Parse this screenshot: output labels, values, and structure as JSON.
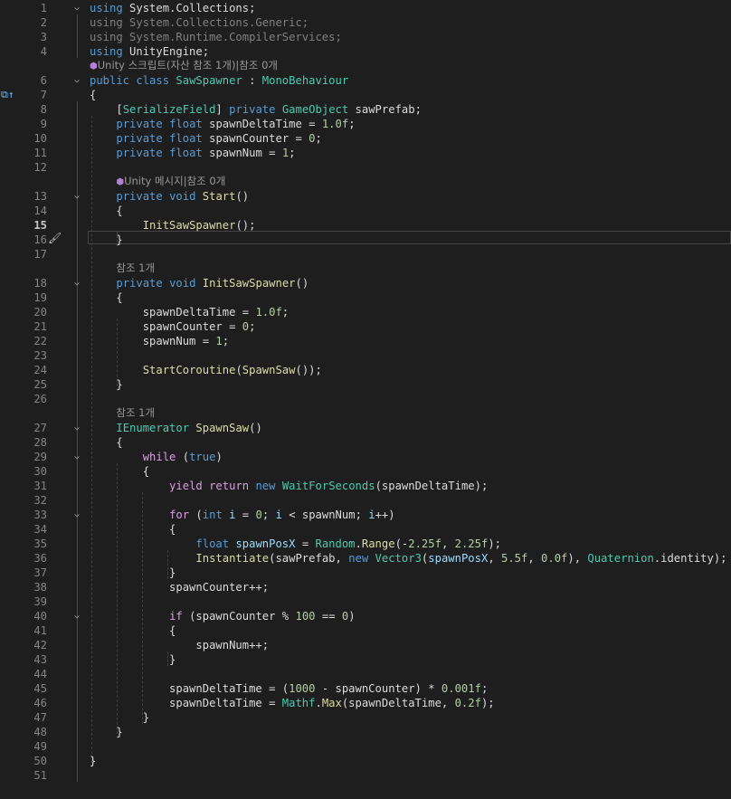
{
  "editor": {
    "active_line": 15,
    "lines": [
      {
        "n": 1,
        "fold": "v",
        "code": [
          [
            "k",
            "using"
          ],
          [
            "p",
            " System.Collections;"
          ]
        ]
      },
      {
        "n": 2,
        "code": [
          [
            "d",
            "using System.Collections.Generic;"
          ]
        ]
      },
      {
        "n": 3,
        "code": [
          [
            "d",
            "using System.Runtime.CompilerServices;"
          ]
        ]
      },
      {
        "n": 4,
        "code": [
          [
            "k",
            "using"
          ],
          [
            "p",
            " UnityEngine;"
          ]
        ]
      },
      {
        "lens": "Unity 스크립트(자산 참조 1개)|참조 0개",
        "icon": "unity-icon"
      },
      {
        "n": 6,
        "fold": "v",
        "code": [
          [
            "k",
            "public"
          ],
          [
            "p",
            " "
          ],
          [
            "k",
            "class"
          ],
          [
            "p",
            " "
          ],
          [
            "t",
            "SawSpawner"
          ],
          [
            "p",
            " : "
          ],
          [
            "t",
            "MonoBehaviour"
          ]
        ]
      },
      {
        "n": 7,
        "code": [
          [
            "p",
            "{"
          ]
        ]
      },
      {
        "n": 8,
        "code": [
          [
            "p",
            "    ["
          ],
          [
            "t",
            "SerializeField"
          ],
          [
            "p",
            "] "
          ],
          [
            "k",
            "private"
          ],
          [
            "p",
            " "
          ],
          [
            "t",
            "GameObject"
          ],
          [
            "p",
            " sawPrefab;"
          ]
        ]
      },
      {
        "n": 9,
        "code": [
          [
            "p",
            "    "
          ],
          [
            "k",
            "private"
          ],
          [
            "p",
            " "
          ],
          [
            "k",
            "float"
          ],
          [
            "p",
            " spawnDeltaTime = "
          ],
          [
            "n",
            "1.0f"
          ],
          [
            "p",
            ";"
          ]
        ]
      },
      {
        "n": 10,
        "code": [
          [
            "p",
            "    "
          ],
          [
            "k",
            "private"
          ],
          [
            "p",
            " "
          ],
          [
            "k",
            "float"
          ],
          [
            "p",
            " spawnCounter = "
          ],
          [
            "n",
            "0"
          ],
          [
            "p",
            ";"
          ]
        ]
      },
      {
        "n": 11,
        "code": [
          [
            "p",
            "    "
          ],
          [
            "k",
            "private"
          ],
          [
            "p",
            " "
          ],
          [
            "k",
            "float"
          ],
          [
            "p",
            " spawnNum = "
          ],
          [
            "n",
            "1"
          ],
          [
            "p",
            ";"
          ]
        ]
      },
      {
        "n": 12,
        "code": []
      },
      {
        "lens": "    Unity 메시지|참조 0개",
        "icon": "unity-icon"
      },
      {
        "n": 13,
        "fold": "v",
        "code": [
          [
            "p",
            "    "
          ],
          [
            "k",
            "private"
          ],
          [
            "p",
            " "
          ],
          [
            "k",
            "void"
          ],
          [
            "p",
            " "
          ],
          [
            "m",
            "Start"
          ],
          [
            "p",
            "()"
          ]
        ]
      },
      {
        "n": 14,
        "code": [
          [
            "p",
            "    {"
          ]
        ]
      },
      {
        "n": 15,
        "code": [
          [
            "p",
            "        "
          ],
          [
            "m",
            "InitSawSpawner"
          ],
          [
            "p",
            "();"
          ]
        ]
      },
      {
        "n": 16,
        "code": [
          [
            "p",
            "    }"
          ]
        ]
      },
      {
        "n": 17,
        "code": []
      },
      {
        "lens": "    참조 1개"
      },
      {
        "n": 18,
        "fold": "v",
        "code": [
          [
            "p",
            "    "
          ],
          [
            "k",
            "private"
          ],
          [
            "p",
            " "
          ],
          [
            "k",
            "void"
          ],
          [
            "p",
            " "
          ],
          [
            "m",
            "InitSawSpawner"
          ],
          [
            "p",
            "()"
          ]
        ]
      },
      {
        "n": 19,
        "code": [
          [
            "p",
            "    {"
          ]
        ]
      },
      {
        "n": 20,
        "code": [
          [
            "p",
            "        spawnDeltaTime = "
          ],
          [
            "n",
            "1.0f"
          ],
          [
            "p",
            ";"
          ]
        ]
      },
      {
        "n": 21,
        "code": [
          [
            "p",
            "        spawnCounter = "
          ],
          [
            "n",
            "0"
          ],
          [
            "p",
            ";"
          ]
        ]
      },
      {
        "n": 22,
        "code": [
          [
            "p",
            "        spawnNum = "
          ],
          [
            "n",
            "1"
          ],
          [
            "p",
            ";"
          ]
        ]
      },
      {
        "n": 23,
        "code": []
      },
      {
        "n": 24,
        "code": [
          [
            "p",
            "        "
          ],
          [
            "m",
            "StartCoroutine"
          ],
          [
            "p",
            "("
          ],
          [
            "m",
            "SpawnSaw"
          ],
          [
            "p",
            "());"
          ]
        ]
      },
      {
        "n": 25,
        "code": [
          [
            "p",
            "    }"
          ]
        ]
      },
      {
        "n": 26,
        "code": []
      },
      {
        "lens": "    참조 1개"
      },
      {
        "n": 27,
        "fold": "v",
        "code": [
          [
            "p",
            "    "
          ],
          [
            "t",
            "IEnumerator"
          ],
          [
            "p",
            " "
          ],
          [
            "m",
            "SpawnSaw"
          ],
          [
            "p",
            "()"
          ]
        ]
      },
      {
        "n": 28,
        "code": [
          [
            "p",
            "    {"
          ]
        ]
      },
      {
        "n": 29,
        "fold": "v",
        "code": [
          [
            "p",
            "        "
          ],
          [
            "c",
            "while"
          ],
          [
            "p",
            " ("
          ],
          [
            "k",
            "true"
          ],
          [
            "p",
            ")"
          ]
        ]
      },
      {
        "n": 30,
        "code": [
          [
            "p",
            "        {"
          ]
        ]
      },
      {
        "n": 31,
        "code": [
          [
            "p",
            "            "
          ],
          [
            "c",
            "yield"
          ],
          [
            "p",
            " "
          ],
          [
            "c",
            "return"
          ],
          [
            "p",
            " "
          ],
          [
            "k",
            "new"
          ],
          [
            "p",
            " "
          ],
          [
            "t",
            "WaitForSeconds"
          ],
          [
            "p",
            "(spawnDeltaTime);"
          ]
        ]
      },
      {
        "n": 32,
        "code": []
      },
      {
        "n": 33,
        "fold": "v",
        "code": [
          [
            "p",
            "            "
          ],
          [
            "c",
            "for"
          ],
          [
            "p",
            " ("
          ],
          [
            "k",
            "int"
          ],
          [
            "p",
            " "
          ],
          [
            "v",
            "i"
          ],
          [
            "p",
            " = "
          ],
          [
            "n",
            "0"
          ],
          [
            "p",
            "; "
          ],
          [
            "v",
            "i"
          ],
          [
            "p",
            " < spawnNum; "
          ],
          [
            "v",
            "i"
          ],
          [
            "p",
            "++)"
          ]
        ]
      },
      {
        "n": 34,
        "code": [
          [
            "p",
            "            {"
          ]
        ]
      },
      {
        "n": 35,
        "code": [
          [
            "p",
            "                "
          ],
          [
            "k",
            "float"
          ],
          [
            "p",
            " "
          ],
          [
            "v",
            "spawnPosX"
          ],
          [
            "p",
            " = "
          ],
          [
            "t",
            "Random"
          ],
          [
            "p",
            "."
          ],
          [
            "m",
            "Range"
          ],
          [
            "p",
            "(-"
          ],
          [
            "n",
            "2.25f"
          ],
          [
            "p",
            ", "
          ],
          [
            "n",
            "2.25f"
          ],
          [
            "p",
            ");"
          ]
        ]
      },
      {
        "n": 36,
        "code": [
          [
            "p",
            "                "
          ],
          [
            "m",
            "Instantiate"
          ],
          [
            "p",
            "(sawPrefab, "
          ],
          [
            "k",
            "new"
          ],
          [
            "p",
            " "
          ],
          [
            "t",
            "Vector3"
          ],
          [
            "p",
            "("
          ],
          [
            "v",
            "spawnPosX"
          ],
          [
            "p",
            ", "
          ],
          [
            "n",
            "5.5f"
          ],
          [
            "p",
            ", "
          ],
          [
            "n",
            "0.0f"
          ],
          [
            "p",
            "), "
          ],
          [
            "t",
            "Quaternion"
          ],
          [
            "p",
            ".identity);"
          ]
        ]
      },
      {
        "n": 37,
        "code": [
          [
            "p",
            "            }"
          ]
        ]
      },
      {
        "n": 38,
        "code": [
          [
            "p",
            "            spawnCounter++;"
          ]
        ]
      },
      {
        "n": 39,
        "code": []
      },
      {
        "n": 40,
        "fold": "v",
        "code": [
          [
            "p",
            "            "
          ],
          [
            "c",
            "if"
          ],
          [
            "p",
            " (spawnCounter % "
          ],
          [
            "n",
            "100"
          ],
          [
            "p",
            " == "
          ],
          [
            "n",
            "0"
          ],
          [
            "p",
            ")"
          ]
        ]
      },
      {
        "n": 41,
        "code": [
          [
            "p",
            "            {"
          ]
        ]
      },
      {
        "n": 42,
        "code": [
          [
            "p",
            "                spawnNum++;"
          ]
        ]
      },
      {
        "n": 43,
        "code": [
          [
            "p",
            "            }"
          ]
        ]
      },
      {
        "n": 44,
        "code": []
      },
      {
        "n": 45,
        "code": [
          [
            "p",
            "            spawnDeltaTime = ("
          ],
          [
            "n",
            "1000"
          ],
          [
            "p",
            " - spawnCounter) * "
          ],
          [
            "n",
            "0.001f"
          ],
          [
            "p",
            ";"
          ]
        ]
      },
      {
        "n": 46,
        "code": [
          [
            "p",
            "            spawnDeltaTime = "
          ],
          [
            "t",
            "Mathf"
          ],
          [
            "p",
            "."
          ],
          [
            "m",
            "Max"
          ],
          [
            "p",
            "(spawnDeltaTime, "
          ],
          [
            "n",
            "0.2f"
          ],
          [
            "p",
            ");"
          ]
        ]
      },
      {
        "n": 47,
        "code": [
          [
            "p",
            "        }"
          ]
        ]
      },
      {
        "n": 48,
        "code": [
          [
            "p",
            "    }"
          ]
        ]
      },
      {
        "n": 49,
        "code": []
      },
      {
        "n": 50,
        "code": [
          [
            "p",
            "}"
          ]
        ]
      },
      {
        "n": 51,
        "code": []
      }
    ]
  },
  "gutter": {
    "line6_marker_icon": "implementation-arrow-icon",
    "line15_marker_icon": "quick-actions-brush-icon"
  }
}
